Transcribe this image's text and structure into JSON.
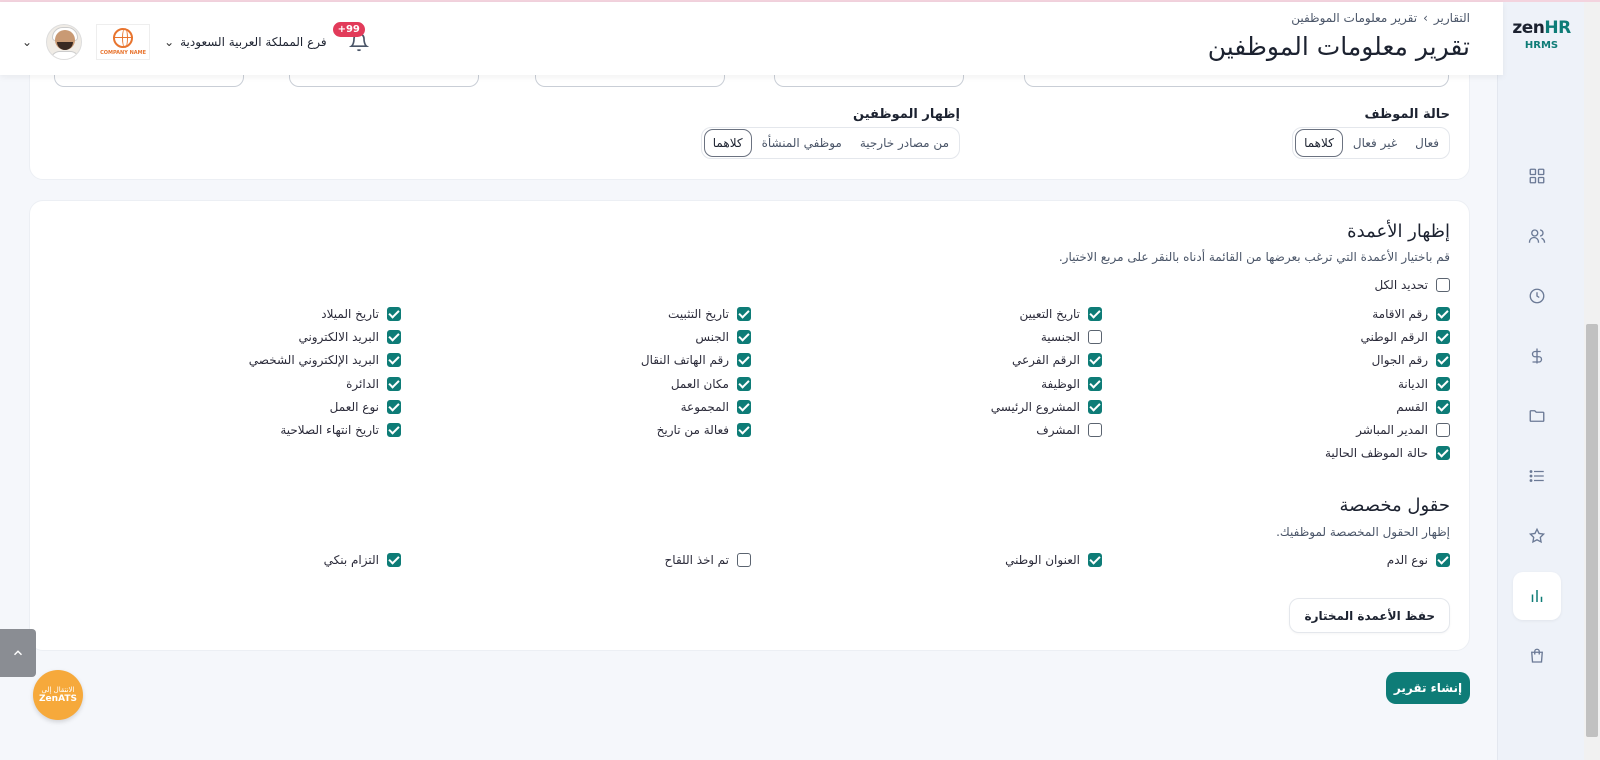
{
  "app": {
    "logo_main": "zen",
    "logo_hr": "HR",
    "logo_sub": "HRMS"
  },
  "nav": [
    "grid-icon",
    "users-icon",
    "clock-icon",
    "dollar-icon",
    "folder-icon",
    "list-icon",
    "star-icon",
    "chart-icon",
    "bag-icon"
  ],
  "header": {
    "breadcrumb_root": "التقارير",
    "breadcrumb_sep": "›",
    "breadcrumb_current": "تقرير معلومات الموظفين",
    "title": "تقرير معلومات الموظفين",
    "notification_count": "+99",
    "branch": "فرع المملكة العربية السعودية",
    "company_logo_text": "COMPANY NAME"
  },
  "filters": {
    "employee_status_label": "حالة الموظف",
    "employee_status_options": [
      "فعال",
      "غير فعال",
      "كلاهما"
    ],
    "employee_status_selected": "كلاهما",
    "show_employees_label": "إظهار الموظفين",
    "show_employees_options": [
      "من مصادر خارجية",
      "موظفي المنشأة",
      "كلاهما"
    ],
    "show_employees_selected": "كلاهما"
  },
  "columns": {
    "title": "إظهار الأعمدة",
    "description": "قم باختيار الأعمدة التي ترغب بعرضها من القائمة أدناه بالنقر على مربع الاختيار.",
    "select_all": "تحديد الكل",
    "col1": [
      {
        "label": "رقم الاقامة",
        "checked": true
      },
      {
        "label": "الرقم الوطني",
        "checked": true
      },
      {
        "label": "رقم الجوال",
        "checked": true
      },
      {
        "label": "الديانة",
        "checked": true
      },
      {
        "label": "القسم",
        "checked": true
      },
      {
        "label": "المدير المباشر",
        "checked": false
      },
      {
        "label": "حالة الموظف الحالية",
        "checked": true
      }
    ],
    "col2": [
      {
        "label": "تاريخ التعيين",
        "checked": true
      },
      {
        "label": "الجنسية",
        "checked": false
      },
      {
        "label": "الرقم الفرعي",
        "checked": true
      },
      {
        "label": "الوظيفة",
        "checked": true
      },
      {
        "label": "المشروع الرئيسي",
        "checked": true
      },
      {
        "label": "المشرف",
        "checked": false
      }
    ],
    "col3": [
      {
        "label": "تاريخ التثبيت",
        "checked": true
      },
      {
        "label": "الجنس",
        "checked": true
      },
      {
        "label": "رقم الهاتف النقال",
        "checked": true
      },
      {
        "label": "مكان العمل",
        "checked": true
      },
      {
        "label": "المجموعة",
        "checked": true
      },
      {
        "label": "فعالة من تاريخ",
        "checked": true
      }
    ],
    "col4": [
      {
        "label": "تاريخ الميلاد",
        "checked": true
      },
      {
        "label": "البريد الالكتروني",
        "checked": true
      },
      {
        "label": "البريد الإلكتروني الشخصي",
        "checked": true
      },
      {
        "label": "الدائرة",
        "checked": true
      },
      {
        "label": "نوع العمل",
        "checked": true
      },
      {
        "label": "تاريخ انتهاء الصلاحية",
        "checked": true
      }
    ]
  },
  "custom_fields": {
    "title": "حقول مخصصة",
    "description": "إظهار الحقول المخصصة لموظفيك.",
    "items": [
      {
        "label": "نوع الدم",
        "checked": true
      },
      {
        "label": "العنوان الوطني",
        "checked": true
      },
      {
        "label": "تم اخذ اللقاح",
        "checked": false
      },
      {
        "label": "التزام بنكي",
        "checked": true
      }
    ]
  },
  "actions": {
    "save_columns": "حفظ الأعمدة المختارة",
    "generate_report": "إنشاء تقرير"
  },
  "zenats": {
    "line1": "الانتقال إلى",
    "line2": "ZenATS"
  }
}
